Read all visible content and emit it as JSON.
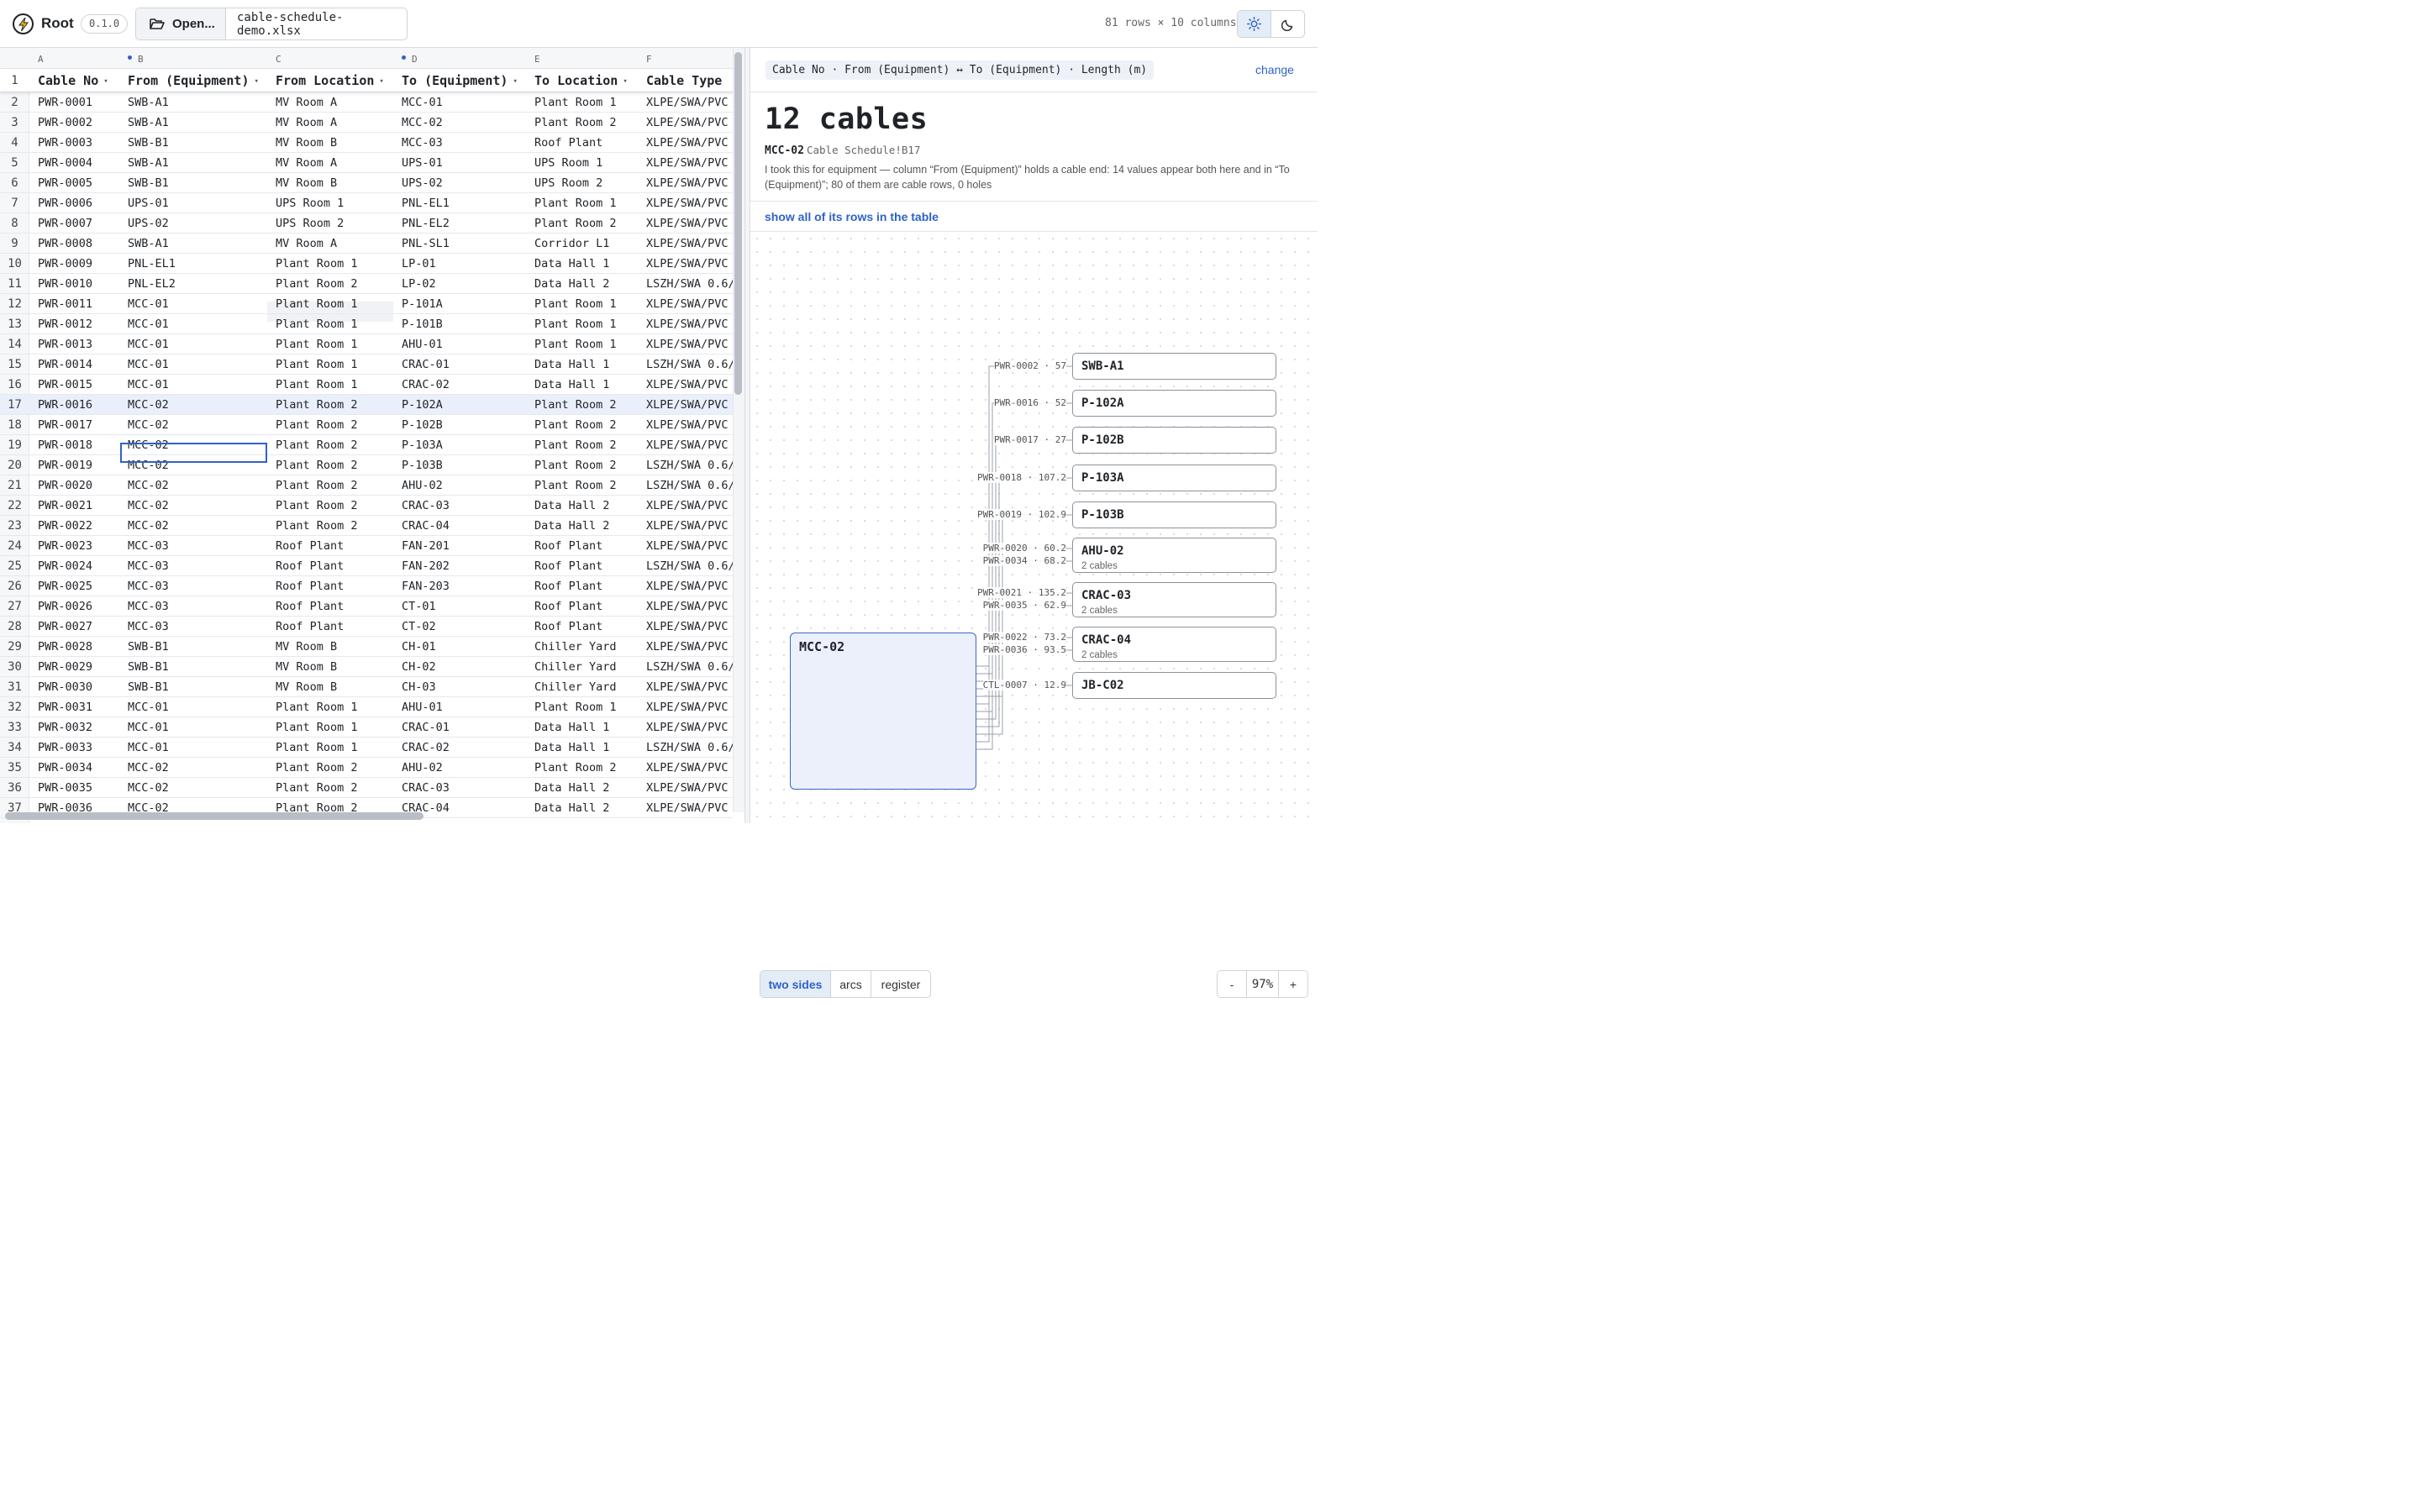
{
  "app": {
    "name": "Root",
    "version": "0.1.0"
  },
  "toolbar": {
    "open_label": "Open...",
    "file_name": "cable-schedule-demo.xlsx",
    "dims": "81 rows × 10 columns"
  },
  "sheet": {
    "column_letters": [
      "A",
      "B",
      "C",
      "D",
      "E",
      "F"
    ],
    "marked_columns": [
      "B",
      "D"
    ],
    "headers": [
      "Cable No",
      "From (Equipment)",
      "From Location",
      "To (Equipment)",
      "To Location",
      "Cable Type"
    ],
    "header_row_number": "1",
    "selected_row": "17",
    "selected_column": "B",
    "rows": [
      {
        "n": "2",
        "cells": [
          "PWR-0001",
          "SWB-A1",
          "MV Room A",
          "MCC-01",
          "Plant Room 1",
          "XLPE/SWA/PVC"
        ]
      },
      {
        "n": "3",
        "cells": [
          "PWR-0002",
          "SWB-A1",
          "MV Room A",
          "MCC-02",
          "Plant Room 2",
          "XLPE/SWA/PVC"
        ]
      },
      {
        "n": "4",
        "cells": [
          "PWR-0003",
          "SWB-B1",
          "MV Room B",
          "MCC-03",
          "Roof Plant",
          "XLPE/SWA/PVC"
        ]
      },
      {
        "n": "5",
        "cells": [
          "PWR-0004",
          "SWB-A1",
          "MV Room A",
          "UPS-01",
          "UPS Room 1",
          "XLPE/SWA/PVC"
        ]
      },
      {
        "n": "6",
        "cells": [
          "PWR-0005",
          "SWB-B1",
          "MV Room B",
          "UPS-02",
          "UPS Room 2",
          "XLPE/SWA/PVC"
        ]
      },
      {
        "n": "7",
        "cells": [
          "PWR-0006",
          "UPS-01",
          "UPS Room 1",
          "PNL-EL1",
          "Plant Room 1",
          "XLPE/SWA/PVC"
        ]
      },
      {
        "n": "8",
        "cells": [
          "PWR-0007",
          "UPS-02",
          "UPS Room 2",
          "PNL-EL2",
          "Plant Room 2",
          "XLPE/SWA/PVC"
        ]
      },
      {
        "n": "9",
        "cells": [
          "PWR-0008",
          "SWB-A1",
          "MV Room A",
          "PNL-SL1",
          "Corridor L1",
          "XLPE/SWA/PVC"
        ]
      },
      {
        "n": "10",
        "cells": [
          "PWR-0009",
          "PNL-EL1",
          "Plant Room 1",
          "LP-01",
          "Data Hall 1",
          "XLPE/SWA/PVC"
        ]
      },
      {
        "n": "11",
        "cells": [
          "PWR-0010",
          "PNL-EL2",
          "Plant Room 2",
          "LP-02",
          "Data Hall 2",
          "LSZH/SWA 0.6/"
        ]
      },
      {
        "n": "12",
        "cells": [
          "PWR-0011",
          "MCC-01",
          "Plant Room 1",
          "P-101A",
          "Plant Room 1",
          "XLPE/SWA/PVC"
        ]
      },
      {
        "n": "13",
        "cells": [
          "PWR-0012",
          "MCC-01",
          "Plant Room 1",
          "P-101B",
          "Plant Room 1",
          "XLPE/SWA/PVC"
        ]
      },
      {
        "n": "14",
        "cells": [
          "PWR-0013",
          "MCC-01",
          "Plant Room 1",
          "AHU-01",
          "Plant Room 1",
          "XLPE/SWA/PVC"
        ]
      },
      {
        "n": "15",
        "cells": [
          "PWR-0014",
          "MCC-01",
          "Plant Room 1",
          "CRAC-01",
          "Data Hall 1",
          "LSZH/SWA 0.6/"
        ]
      },
      {
        "n": "16",
        "cells": [
          "PWR-0015",
          "MCC-01",
          "Plant Room 1",
          "CRAC-02",
          "Data Hall 1",
          "XLPE/SWA/PVC"
        ]
      },
      {
        "n": "17",
        "cells": [
          "PWR-0016",
          "MCC-02",
          "Plant Room 2",
          "P-102A",
          "Plant Room 2",
          "XLPE/SWA/PVC"
        ]
      },
      {
        "n": "18",
        "cells": [
          "PWR-0017",
          "MCC-02",
          "Plant Room 2",
          "P-102B",
          "Plant Room 2",
          "XLPE/SWA/PVC"
        ]
      },
      {
        "n": "19",
        "cells": [
          "PWR-0018",
          "MCC-02",
          "Plant Room 2",
          "P-103A",
          "Plant Room 2",
          "XLPE/SWA/PVC"
        ]
      },
      {
        "n": "20",
        "cells": [
          "PWR-0019",
          "MCC-02",
          "Plant Room 2",
          "P-103B",
          "Plant Room 2",
          "LSZH/SWA 0.6/"
        ]
      },
      {
        "n": "21",
        "cells": [
          "PWR-0020",
          "MCC-02",
          "Plant Room 2",
          "AHU-02",
          "Plant Room 2",
          "LSZH/SWA 0.6/"
        ]
      },
      {
        "n": "22",
        "cells": [
          "PWR-0021",
          "MCC-02",
          "Plant Room 2",
          "CRAC-03",
          "Data Hall 2",
          "XLPE/SWA/PVC"
        ]
      },
      {
        "n": "23",
        "cells": [
          "PWR-0022",
          "MCC-02",
          "Plant Room 2",
          "CRAC-04",
          "Data Hall 2",
          "XLPE/SWA/PVC"
        ]
      },
      {
        "n": "24",
        "cells": [
          "PWR-0023",
          "MCC-03",
          "Roof Plant",
          "FAN-201",
          "Roof Plant",
          "XLPE/SWA/PVC"
        ]
      },
      {
        "n": "25",
        "cells": [
          "PWR-0024",
          "MCC-03",
          "Roof Plant",
          "FAN-202",
          "Roof Plant",
          "LSZH/SWA 0.6/"
        ]
      },
      {
        "n": "26",
        "cells": [
          "PWR-0025",
          "MCC-03",
          "Roof Plant",
          "FAN-203",
          "Roof Plant",
          "XLPE/SWA/PVC"
        ]
      },
      {
        "n": "27",
        "cells": [
          "PWR-0026",
          "MCC-03",
          "Roof Plant",
          "CT-01",
          "Roof Plant",
          "XLPE/SWA/PVC"
        ]
      },
      {
        "n": "28",
        "cells": [
          "PWR-0027",
          "MCC-03",
          "Roof Plant",
          "CT-02",
          "Roof Plant",
          "XLPE/SWA/PVC"
        ]
      },
      {
        "n": "29",
        "cells": [
          "PWR-0028",
          "SWB-B1",
          "MV Room B",
          "CH-01",
          "Chiller Yard",
          "XLPE/SWA/PVC"
        ]
      },
      {
        "n": "30",
        "cells": [
          "PWR-0029",
          "SWB-B1",
          "MV Room B",
          "CH-02",
          "Chiller Yard",
          "LSZH/SWA 0.6/"
        ]
      },
      {
        "n": "31",
        "cells": [
          "PWR-0030",
          "SWB-B1",
          "MV Room B",
          "CH-03",
          "Chiller Yard",
          "XLPE/SWA/PVC"
        ]
      },
      {
        "n": "32",
        "cells": [
          "PWR-0031",
          "MCC-01",
          "Plant Room 1",
          "AHU-01",
          "Plant Room 1",
          "XLPE/SWA/PVC"
        ]
      },
      {
        "n": "33",
        "cells": [
          "PWR-0032",
          "MCC-01",
          "Plant Room 1",
          "CRAC-01",
          "Data Hall 1",
          "XLPE/SWA/PVC"
        ]
      },
      {
        "n": "34",
        "cells": [
          "PWR-0033",
          "MCC-01",
          "Plant Room 1",
          "CRAC-02",
          "Data Hall 1",
          "LSZH/SWA 0.6/"
        ]
      },
      {
        "n": "35",
        "cells": [
          "PWR-0034",
          "MCC-02",
          "Plant Room 2",
          "AHU-02",
          "Plant Room 2",
          "XLPE/SWA/PVC"
        ]
      },
      {
        "n": "36",
        "cells": [
          "PWR-0035",
          "MCC-02",
          "Plant Room 2",
          "CRAC-03",
          "Data Hall 2",
          "XLPE/SWA/PVC"
        ]
      },
      {
        "n": "37",
        "cells": [
          "PWR-0036",
          "MCC-02",
          "Plant Room 2",
          "CRAC-04",
          "Data Hall 2",
          "XLPE/SWA/PVC"
        ]
      }
    ]
  },
  "panel": {
    "key": "Cable No · From (Equipment) ↔ To (Equipment) · Length (m)",
    "change_label": "change",
    "title": "12 cables",
    "equipment": "MCC-02",
    "cell_ref": "Cable Schedule!B17",
    "explanation": "I took this for equipment — column “From (Equipment)” holds a cable end: 14 values appear both here and in “To (Equipment)”; 80 of them are cable rows, 0 holes",
    "show_all_label": "show all of its rows in the table",
    "hub_label": "MCC-02",
    "nodes": [
      {
        "label": "SWB-A1",
        "sub": "",
        "edges": [
          "PWR-0002 · 57"
        ]
      },
      {
        "label": "P-102A",
        "sub": "",
        "edges": [
          "PWR-0016 · 52"
        ]
      },
      {
        "label": "P-102B",
        "sub": "",
        "edges": [
          "PWR-0017 · 27"
        ]
      },
      {
        "label": "P-103A",
        "sub": "",
        "edges": [
          "PWR-0018 · 107.2"
        ]
      },
      {
        "label": "P-103B",
        "sub": "",
        "edges": [
          "PWR-0019 · 102.9"
        ]
      },
      {
        "label": "AHU-02",
        "sub": "2 cables",
        "edges": [
          "PWR-0020 · 60.2",
          "PWR-0034 · 68.2"
        ]
      },
      {
        "label": "CRAC-03",
        "sub": "2 cables",
        "edges": [
          "PWR-0021 · 135.2",
          "PWR-0035 · 62.9"
        ]
      },
      {
        "label": "CRAC-04",
        "sub": "2 cables",
        "edges": [
          "PWR-0022 · 73.2",
          "PWR-0036 · 93.5"
        ]
      },
      {
        "label": "JB-C02",
        "sub": "",
        "edges": [
          "CTL-0007 · 12.9"
        ]
      }
    ],
    "view_modes": [
      "two sides",
      "arcs",
      "register"
    ],
    "active_view": "two sides",
    "zoom": {
      "out_label": "-",
      "value": "97%",
      "in_label": "+"
    }
  },
  "colors": {
    "accent": "#2f62c9",
    "hub_fill": "#ebf0fb",
    "highlight_row": "#e9f0fc"
  },
  "icons": {
    "logo": "bolt-icon",
    "open": "folder-open-icon",
    "light": "sun-icon",
    "dark": "moon-icon"
  }
}
